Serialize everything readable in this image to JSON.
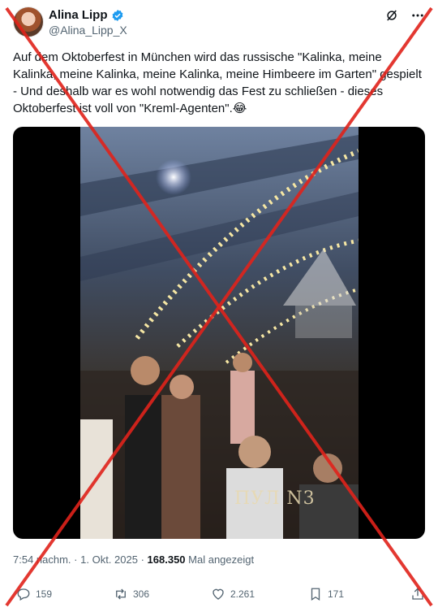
{
  "header": {
    "name": "Alina Lipp",
    "handle": "@Alina_Lipp_X"
  },
  "tweet": {
    "text": "Auf dem Oktoberfest in München wird das russische \"Kalinka, meine Kalinka, meine Kalinka, meine Kalinka, meine Himbeere im Garten\" gespielt - Und deshalb war es wohl notwendig das Fest zu schließen - dieses Oktoberfest ist voll von \"Kreml-Agenten\".😂"
  },
  "media": {
    "watermark": "ПУЛ N3"
  },
  "meta": {
    "time": "7:54 nachm.",
    "date": "1. Okt. 2025",
    "views": "168.350",
    "views_label": "Mal angezeigt"
  },
  "actions": {
    "replies": "159",
    "reposts": "306",
    "likes": "2.261",
    "bookmarks": "171"
  },
  "colors": {
    "verified": "#1d9bf0",
    "cross": "#e0231b",
    "secondary_text": "#536471"
  }
}
